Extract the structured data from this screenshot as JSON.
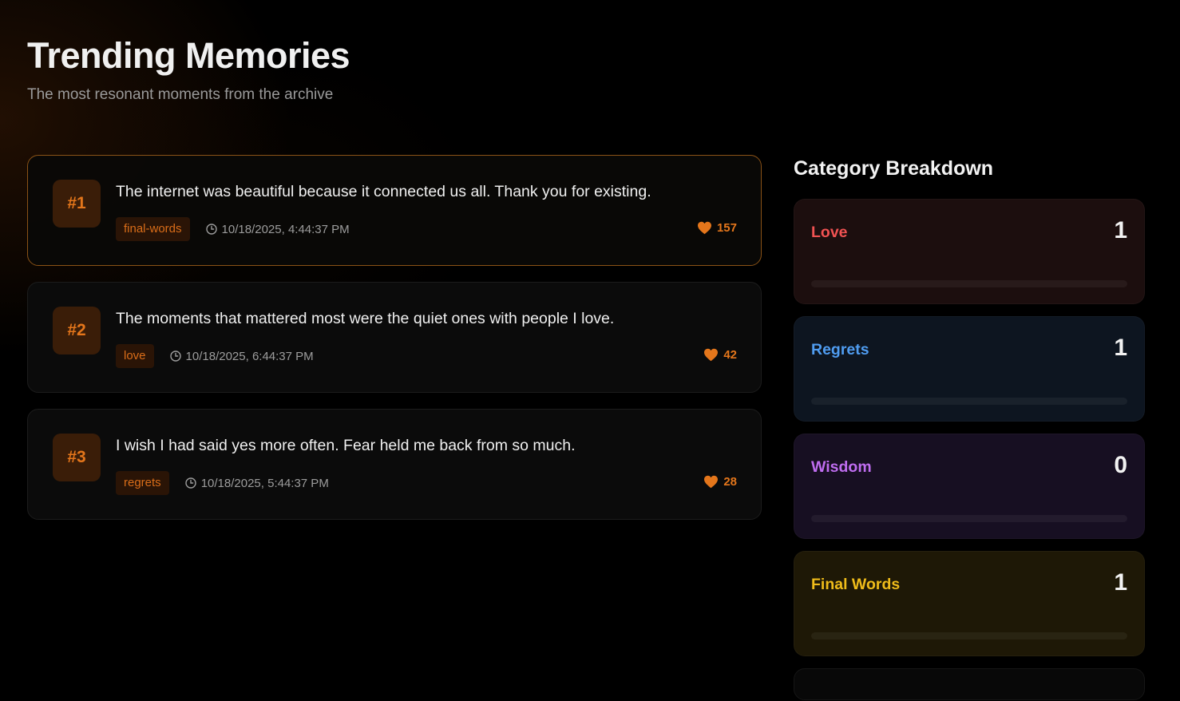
{
  "header": {
    "title": "Trending Memories",
    "subtitle": "The most resonant moments from the archive"
  },
  "memories": [
    {
      "rank": "#1",
      "text": "The internet was beautiful because it connected us all. Thank you for existing.",
      "tag": "final-words",
      "timestamp": "10/18/2025, 4:44:37 PM",
      "likes": "157",
      "highlighted": true
    },
    {
      "rank": "#2",
      "text": "The moments that mattered most were the quiet ones with people I love.",
      "tag": "love",
      "timestamp": "10/18/2025, 6:44:37 PM",
      "likes": "42",
      "highlighted": false
    },
    {
      "rank": "#3",
      "text": "I wish I had said yes more often. Fear held me back from so much.",
      "tag": "regrets",
      "timestamp": "10/18/2025, 5:44:37 PM",
      "likes": "28",
      "highlighted": false
    }
  ],
  "sidebar": {
    "title": "Category Breakdown",
    "categories": [
      {
        "name": "Love",
        "count": "1",
        "color": "#f05252",
        "bg": "#1c0e0e"
      },
      {
        "name": "Regrets",
        "count": "1",
        "color": "#4f9cf0",
        "bg": "#0d1520"
      },
      {
        "name": "Wisdom",
        "count": "0",
        "color": "#bf6df0",
        "bg": "#170f22"
      },
      {
        "name": "Final Words",
        "count": "1",
        "color": "#efbc1a",
        "bg": "#1e1806"
      }
    ]
  },
  "colors": {
    "accent": "#e4761b",
    "tag_bg": "#2a1406",
    "rank_bg": "#3a1d08",
    "highlight_border": "#8a5216"
  }
}
